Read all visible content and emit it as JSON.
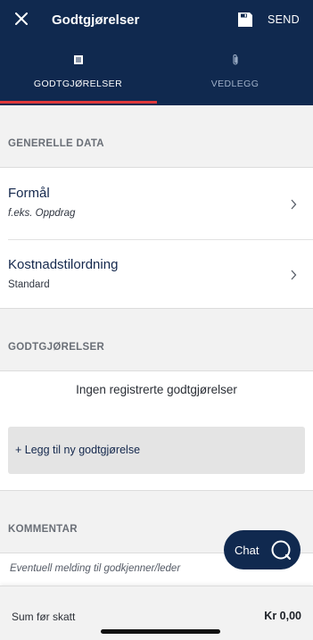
{
  "header": {
    "title": "Godtgjørelser",
    "send_label": "SEND",
    "close_icon": "close-icon",
    "save_icon": "save-icon",
    "background": "#10294f"
  },
  "tabs": [
    {
      "label": "GODTGJØRELSER",
      "icon": "list-icon",
      "active": true
    },
    {
      "label": "VEDLEGG",
      "icon": "paperclip-icon",
      "active": false
    }
  ],
  "general": {
    "header": "GENERELLE DATA",
    "rows": [
      {
        "title": "Formål",
        "value": "f.eks. Oppdrag"
      },
      {
        "title": "Kostnadstilordning",
        "value": "Standard"
      }
    ]
  },
  "allowances": {
    "header": "GODTGJØRELSER",
    "empty_text": "Ingen registrerte godtgjørelser",
    "add_label": "+ Legg til ny godtgjørelse"
  },
  "comment": {
    "header": "KOMMENTAR",
    "placeholder": "Eventuell melding til godkjenner/leder"
  },
  "chat": {
    "label": "Chat",
    "icon": "chat-icon"
  },
  "footer": {
    "label": "Sum før skatt",
    "value": "Kr 0,00"
  },
  "colors": {
    "accent": "#e0383b",
    "navy": "#10294f"
  }
}
